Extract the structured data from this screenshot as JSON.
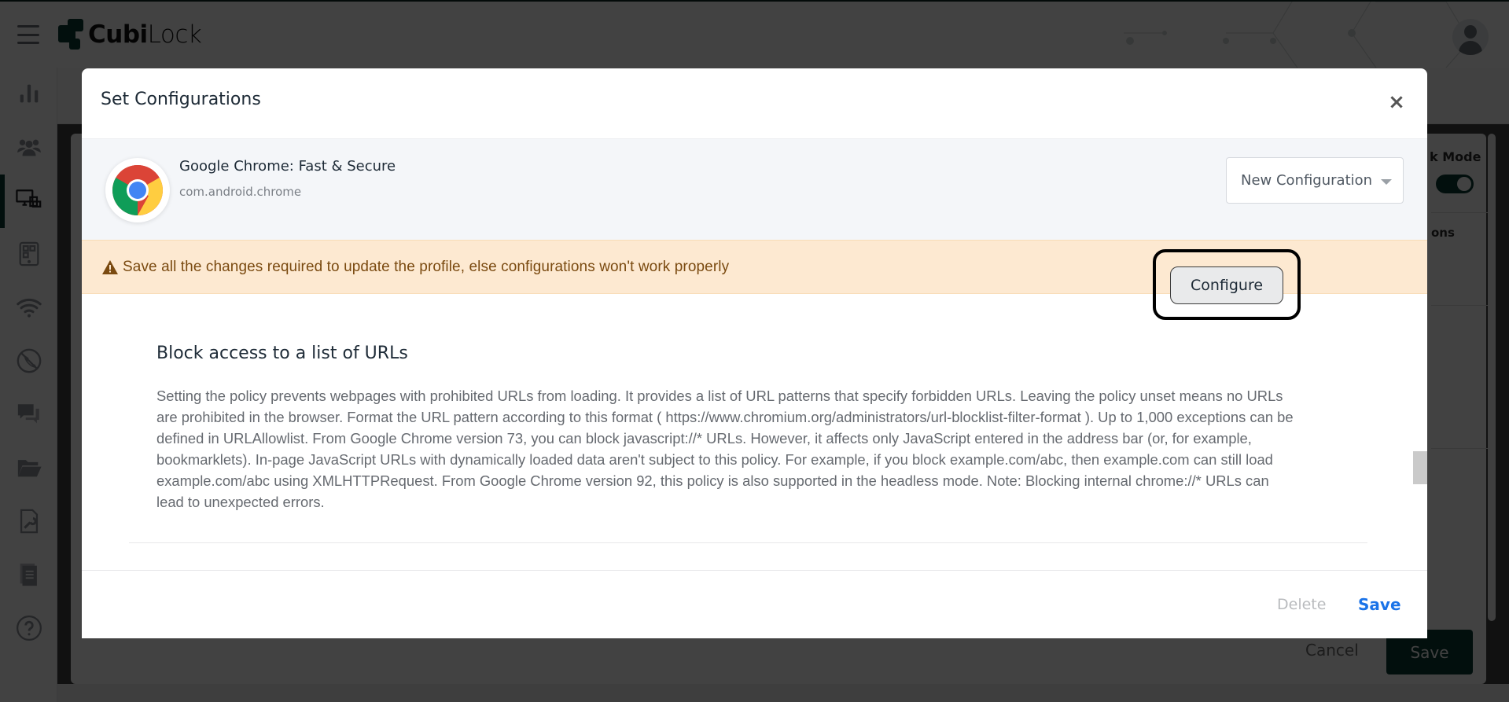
{
  "app": {
    "brand_bold": "Cubi",
    "brand_light": "Lock"
  },
  "sidebar": {
    "items": [
      {
        "icon": "bar-chart-icon"
      },
      {
        "icon": "users-icon"
      },
      {
        "icon": "devices-icon",
        "active": true
      },
      {
        "icon": "tablet-apps-icon"
      },
      {
        "icon": "wifi-icon"
      },
      {
        "icon": "call-block-icon"
      },
      {
        "icon": "chat-icon"
      },
      {
        "icon": "folder-icon"
      },
      {
        "icon": "file-wrench-icon"
      },
      {
        "icon": "documents-icon"
      },
      {
        "icon": "help-icon"
      }
    ]
  },
  "background_page": {
    "kiosk_mode_label": "k Mode",
    "kiosk_mode_enabled": true,
    "options_label": "ons",
    "cancel_label": "Cancel",
    "save_label": "Save"
  },
  "modal": {
    "title": "Set Configurations",
    "close_symbol": "×",
    "app": {
      "name": "Google Chrome: Fast & Secure",
      "package": "com.android.chrome"
    },
    "configuration_select": {
      "selected": "New Configuration"
    },
    "warning": "Save all the changes required to update the profile, else configurations won't work properly",
    "policy": {
      "title": "Block access to a list of URLs",
      "description": "Setting the policy prevents webpages with prohibited URLs from loading. It provides a list of URL patterns that specify forbidden URLs. Leaving the policy unset means no URLs are prohibited in the browser. Format the URL pattern according to this format ( https://www.chromium.org/administrators/url-blocklist-filter-format ). Up to 1,000 exceptions can be defined in URLAllowlist. From Google Chrome version 73, you can block javascript://* URLs. However, it affects only JavaScript entered in the address bar (or, for example, bookmarklets). In-page JavaScript URLs with dynamically loaded data aren't subject to this policy. For example, if you block example.com/abc, then example.com can still load example.com/abc using XMLHTTPRequest. From Google Chrome version 92, this policy is also supported in the headless mode. Note: Blocking internal chrome://* URLs can lead to unexpected errors.",
      "configure_label": "Configure"
    },
    "footer": {
      "delete_label": "Delete",
      "save_label": "Save"
    }
  },
  "colors": {
    "brand": "#0b3a33",
    "warning_bg": "#fde9d1",
    "warning_text": "#7a4a10",
    "link_blue": "#1a73e8"
  }
}
